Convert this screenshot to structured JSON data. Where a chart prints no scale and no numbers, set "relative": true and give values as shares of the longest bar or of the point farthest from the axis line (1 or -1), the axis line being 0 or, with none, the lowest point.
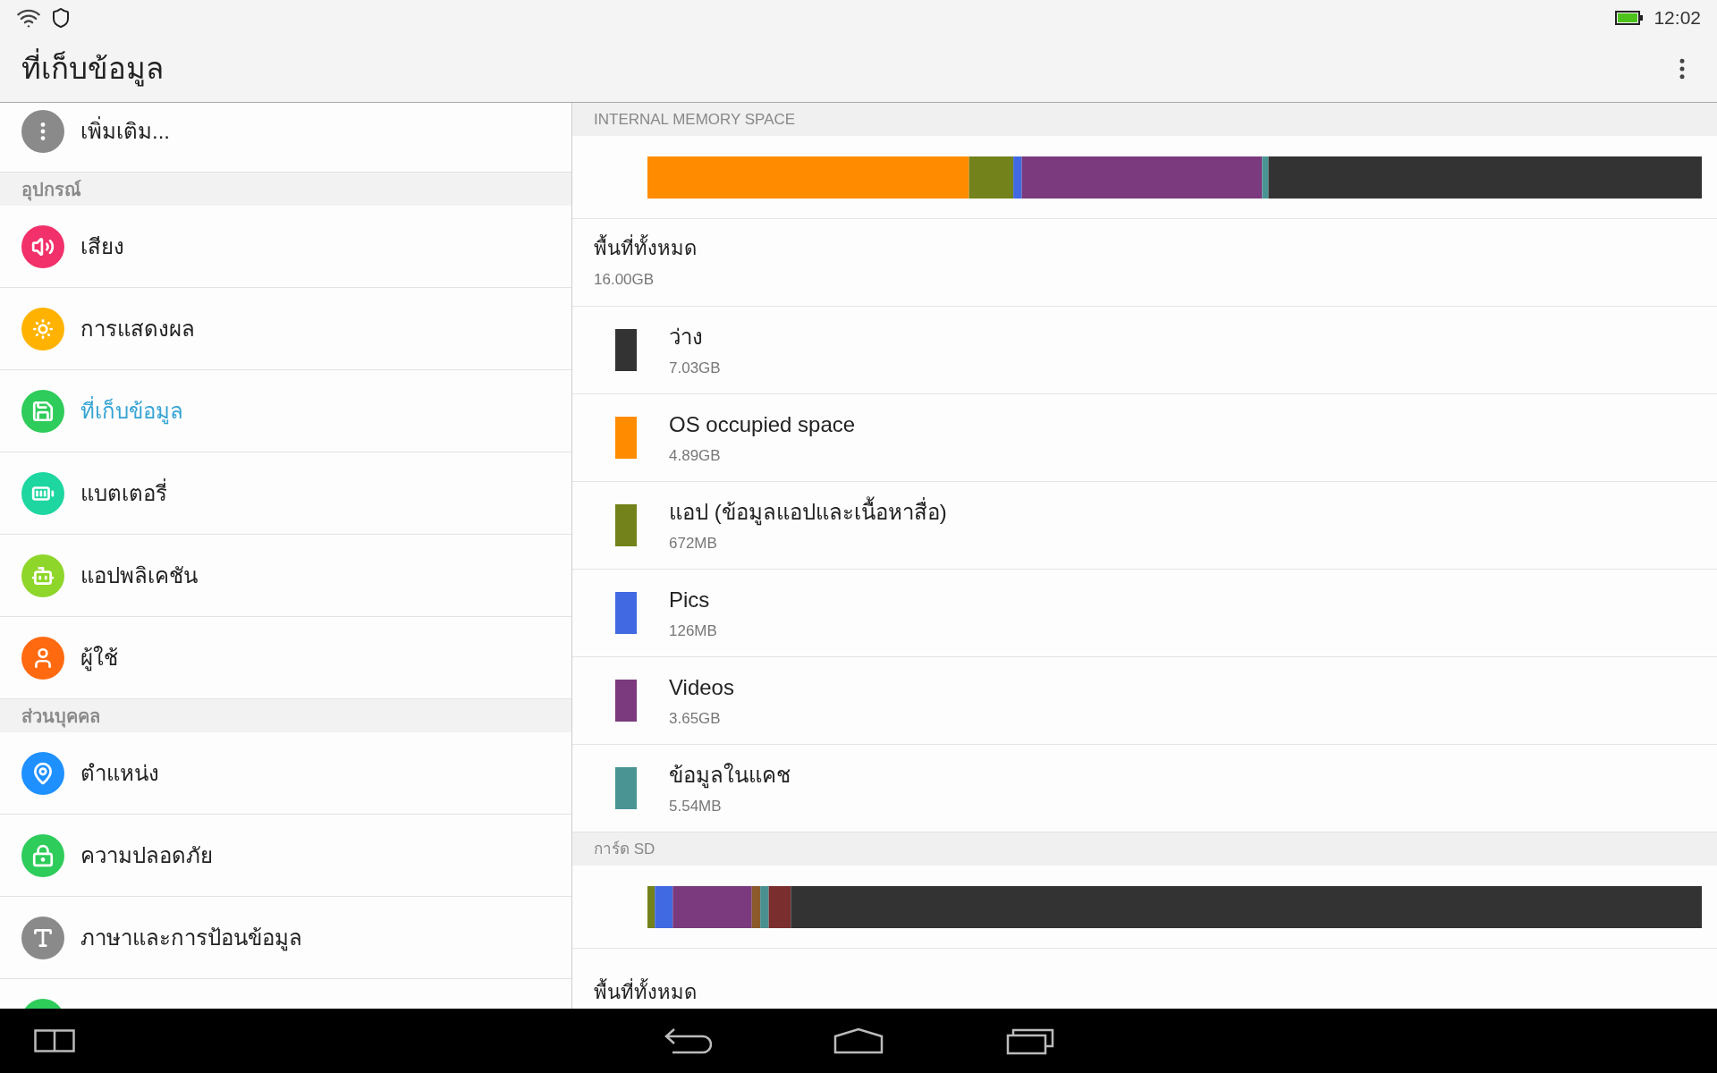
{
  "status_bar": {
    "time": "12:02"
  },
  "app_bar": {
    "title": "ที่เก็บข้อมูล"
  },
  "sidebar": {
    "sections": [
      {
        "items": [
          {
            "label": "เพิ่มเติม...",
            "color": "#8a8a8a",
            "selected": false
          }
        ]
      },
      {
        "header": "อุปกรณ์",
        "items": [
          {
            "label": "เสียง",
            "color": "#f2306a",
            "selected": false
          },
          {
            "label": "การแสดงผล",
            "color": "#ffb300",
            "selected": false
          },
          {
            "label": "ที่เก็บข้อมูล",
            "color": "#2ecc5a",
            "selected": true
          },
          {
            "label": "แบตเตอรี่",
            "color": "#1dd6a0",
            "selected": false
          },
          {
            "label": "แอปพลิเคชัน",
            "color": "#8ed62a",
            "selected": false
          },
          {
            "label": "ผู้ใช้",
            "color": "#ff6a10",
            "selected": false
          }
        ]
      },
      {
        "header": "ส่วนบุคคล",
        "items": [
          {
            "label": "ตำแหน่ง",
            "color": "#1e90ff",
            "selected": false
          },
          {
            "label": "ความปลอดภัย",
            "color": "#2ecc5a",
            "selected": false
          },
          {
            "label": "ภาษาและการป้อนข้อมูล",
            "color": "#8a8a8a",
            "selected": false
          }
        ]
      }
    ]
  },
  "storage": [
    {
      "header": "INTERNAL MEMORY SPACE",
      "chart_data": {
        "type": "bar",
        "orientation": "horizontal",
        "stacked": true,
        "relative": true,
        "series": [
          {
            "color": "#ff8c00",
            "values": [
              0.305
            ]
          },
          {
            "color": "#73821a",
            "values": [
              0.042
            ]
          },
          {
            "color": "#4169e1",
            "values": [
              0.008
            ]
          },
          {
            "color": "#7a3a7d",
            "values": [
              0.228
            ]
          },
          {
            "color": "#4a9494",
            "values": [
              0.006
            ]
          },
          {
            "color": "#333333",
            "values": [
              0.411
            ]
          }
        ]
      },
      "total": {
        "label": "พื้นที่ทั้งหมด",
        "value": "16.00GB"
      },
      "entries": [
        {
          "label": "ว่าง",
          "value": "7.03GB",
          "color": "#333333"
        },
        {
          "label": "OS occupied space",
          "value": "4.89GB",
          "color": "#ff8c00"
        },
        {
          "label": "แอป (ข้อมูลแอปและเนื้อหาสื่อ)",
          "value": "672MB",
          "color": "#73821a"
        },
        {
          "label": "Pics",
          "value": "126MB",
          "color": "#4169e1"
        },
        {
          "label": "Videos",
          "value": "3.65GB",
          "color": "#7a3a7d"
        },
        {
          "label": "ข้อมูลในแคช",
          "value": "5.54MB",
          "color": "#4a9494"
        }
      ]
    },
    {
      "header": "การ์ด SD",
      "chart_data": {
        "type": "bar",
        "orientation": "horizontal",
        "stacked": true,
        "relative": true,
        "series": [
          {
            "color": "#73821a",
            "values": [
              0.007
            ]
          },
          {
            "color": "#4169e1",
            "values": [
              0.017
            ]
          },
          {
            "color": "#7a3a7d",
            "values": [
              0.075
            ]
          },
          {
            "color": "#8b5a2b",
            "values": [
              0.008
            ]
          },
          {
            "color": "#4a9090",
            "values": [
              0.008
            ]
          },
          {
            "color": "#7b2e2e",
            "values": [
              0.021
            ]
          },
          {
            "color": "#333333",
            "values": [
              0.864
            ]
          }
        ]
      },
      "total": {
        "label": "พื้นที่ทั้งหมด"
      }
    }
  ]
}
